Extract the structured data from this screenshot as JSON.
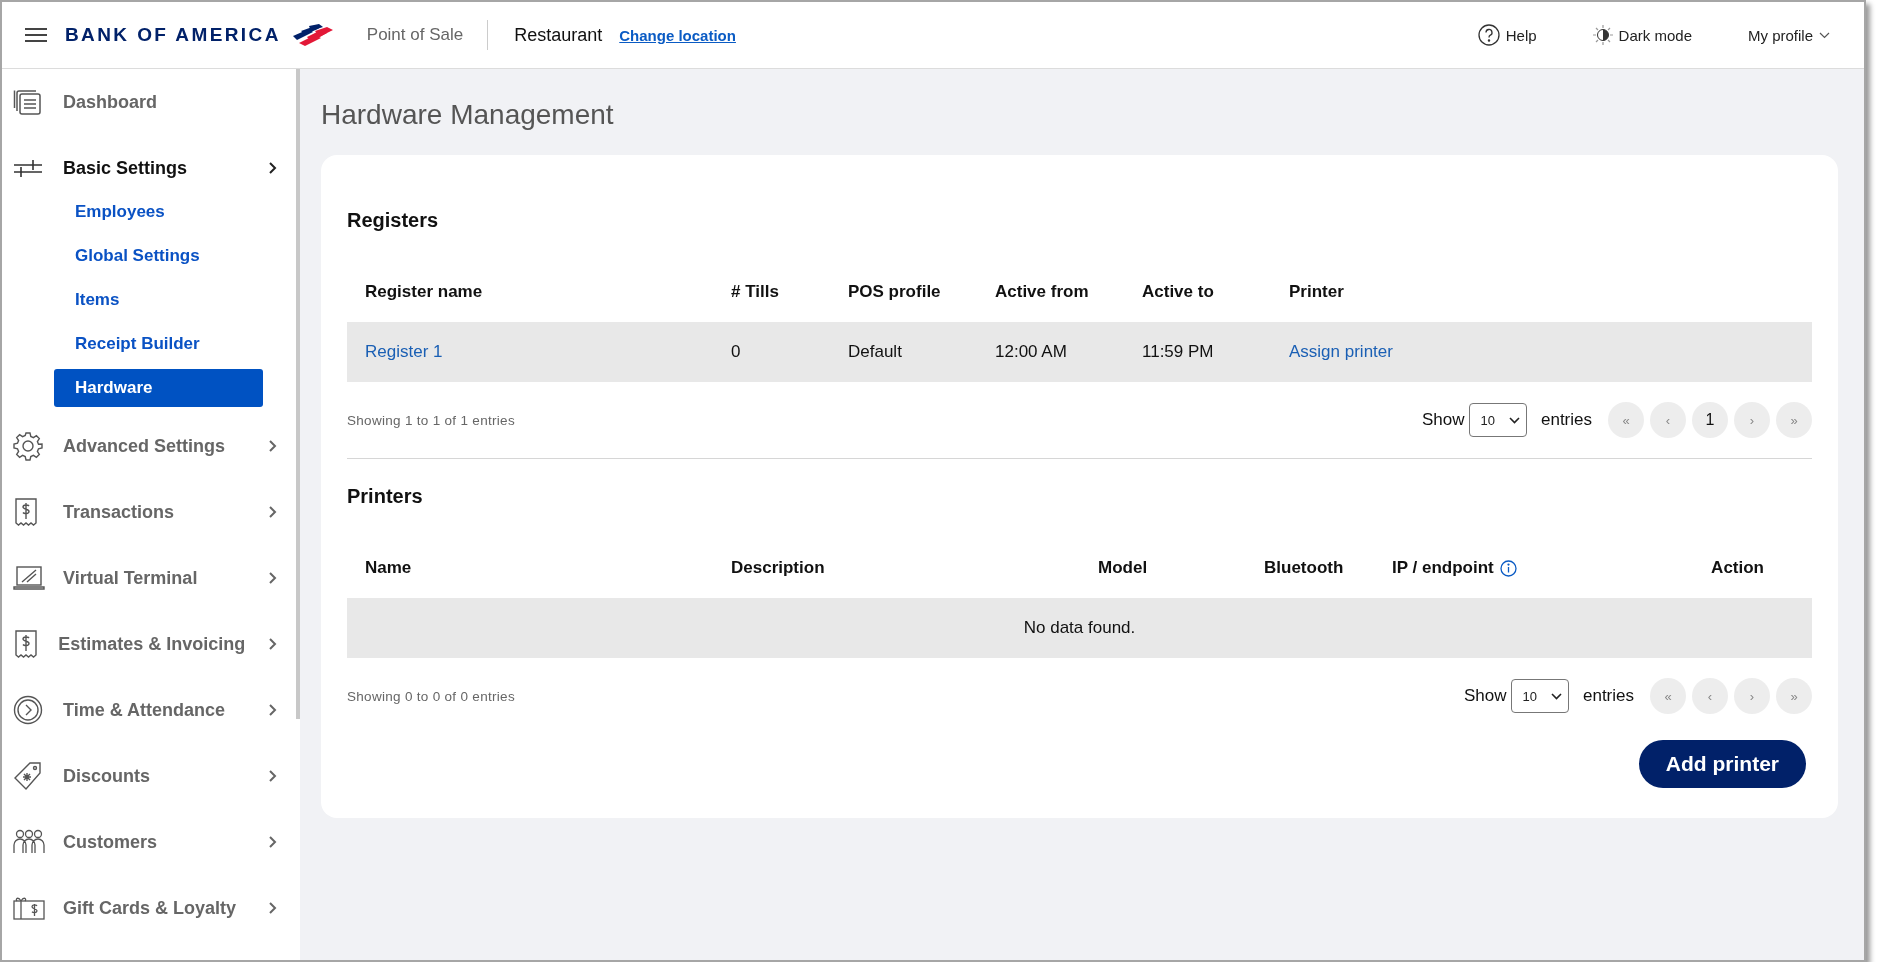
{
  "header": {
    "brand": "BANK OF AMERICA",
    "app": "Point of Sale",
    "location": "Restaurant",
    "change_link": "Change location",
    "actions": [
      {
        "label": "Help",
        "kind": "help"
      },
      {
        "label": "Dark mode",
        "kind": "theme"
      },
      {
        "label": "My profile",
        "kind": "profile"
      }
    ]
  },
  "sidebar": {
    "items": [
      {
        "label": "Dashboard",
        "kind": "link"
      },
      {
        "label": "Basic Settings",
        "kind": "group",
        "expanded": true,
        "children": [
          {
            "label": "Employees",
            "selected": false
          },
          {
            "label": "Global Settings",
            "selected": false
          },
          {
            "label": "Items",
            "selected": false
          },
          {
            "label": "Receipt Builder",
            "selected": false
          },
          {
            "label": "Hardware",
            "selected": true
          }
        ]
      },
      {
        "label": "Advanced Settings",
        "kind": "group",
        "expanded": false
      },
      {
        "label": "Transactions",
        "kind": "group",
        "expanded": false
      },
      {
        "label": "Virtual Terminal",
        "kind": "group",
        "expanded": false
      },
      {
        "label": "Estimates & Invoicing",
        "kind": "group",
        "expanded": false
      },
      {
        "label": "Time & Attendance",
        "kind": "group",
        "expanded": false
      },
      {
        "label": "Discounts",
        "kind": "group",
        "expanded": false
      },
      {
        "label": "Customers",
        "kind": "group",
        "expanded": false
      },
      {
        "label": "Gift Cards & Loyalty",
        "kind": "group",
        "expanded": false
      }
    ]
  },
  "page": {
    "title": "Hardware Management"
  },
  "registers": {
    "title": "Registers",
    "columns": [
      {
        "label": "Register name",
        "info": false
      },
      {
        "label": "# Tills",
        "info": false
      },
      {
        "label": "POS profile",
        "info": false
      },
      {
        "label": "Active from",
        "info": false
      },
      {
        "label": "Active to",
        "info": false
      },
      {
        "label": "Printer",
        "info": false
      }
    ],
    "rows": [
      {
        "cells": [
          {
            "text": "Register 1",
            "kind": "link"
          },
          {
            "text": "0",
            "kind": "text"
          },
          {
            "text": "Default",
            "kind": "text"
          },
          {
            "text": "12:00 AM",
            "kind": "text"
          },
          {
            "text": "11:59 PM",
            "kind": "text"
          },
          {
            "text": "Assign printer",
            "kind": "link"
          }
        ]
      }
    ],
    "info": "Showing 1 to 1 of 1 entries",
    "show_label": "Show",
    "page_size": "10",
    "entries_label": "entries",
    "pager": [
      {
        "label": "«",
        "selected": false
      },
      {
        "label": "‹",
        "selected": false
      },
      {
        "label": "1",
        "selected": true
      },
      {
        "label": "›",
        "selected": false
      },
      {
        "label": "»",
        "selected": false
      }
    ]
  },
  "printers": {
    "title": "Printers",
    "columns": [
      {
        "label": "Name",
        "info": false
      },
      {
        "label": "Description",
        "info": false
      },
      {
        "label": "Model",
        "info": false
      },
      {
        "label": "Bluetooth",
        "info": false
      },
      {
        "label": "IP / endpoint",
        "info": true
      },
      {
        "label": "Action",
        "info": false
      }
    ],
    "empty": "No data found.",
    "info": "Showing 0 to 0 of 0 entries",
    "show_label": "Show",
    "page_size": "10",
    "entries_label": "entries",
    "pager": [
      {
        "label": "«",
        "selected": false
      },
      {
        "label": "‹",
        "selected": false
      },
      {
        "label": "›",
        "selected": false
      },
      {
        "label": "»",
        "selected": false
      }
    ],
    "button": "Add printer"
  }
}
